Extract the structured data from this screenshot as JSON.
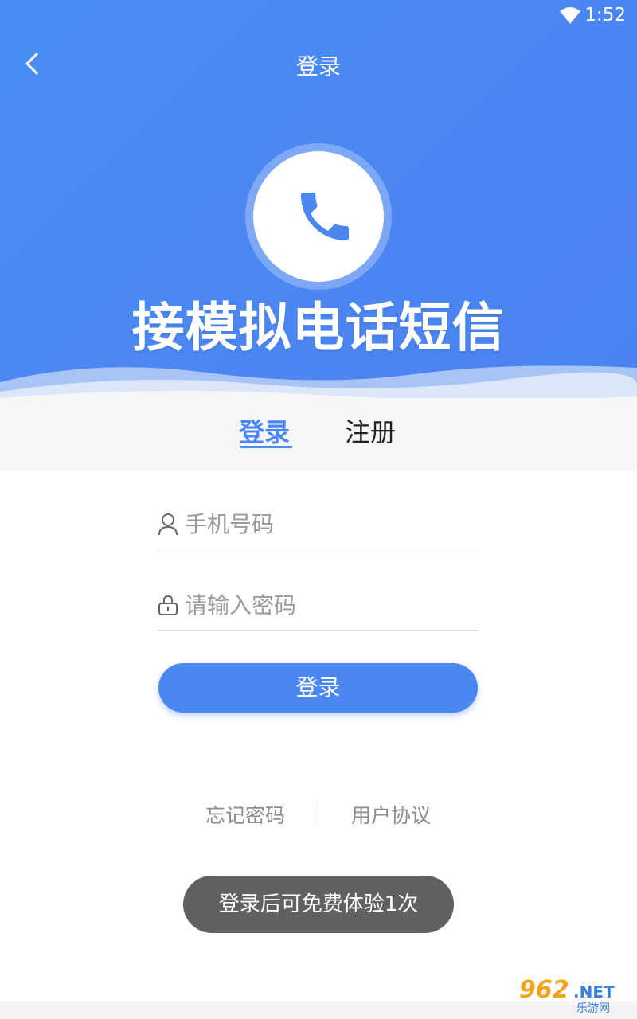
{
  "status_bar": {
    "time": "1:52",
    "wifi_icon": "wifi-icon"
  },
  "nav": {
    "title": "登录",
    "back_icon": "back-chevron-icon"
  },
  "hero": {
    "app_name": "接模拟电话短信",
    "logo_icon": "phone-icon"
  },
  "tabs": {
    "login": "登录",
    "register": "注册",
    "active": "login"
  },
  "form": {
    "phone": {
      "placeholder": "手机号码",
      "value": "",
      "icon": "user-icon"
    },
    "password": {
      "placeholder": "请输入密码",
      "value": "",
      "icon": "lock-icon"
    },
    "submit_label": "登录"
  },
  "links": {
    "forgot": "忘记密码",
    "agreement": "用户协议"
  },
  "toast": {
    "text": "登录后可免费体验1次"
  },
  "watermark": {
    "num": "962",
    "net": ".NET",
    "cn": "乐游网"
  },
  "colors": {
    "primary": "#4a87f0",
    "toast_bg": "#616161",
    "muted_text": "#8d8d8d"
  }
}
